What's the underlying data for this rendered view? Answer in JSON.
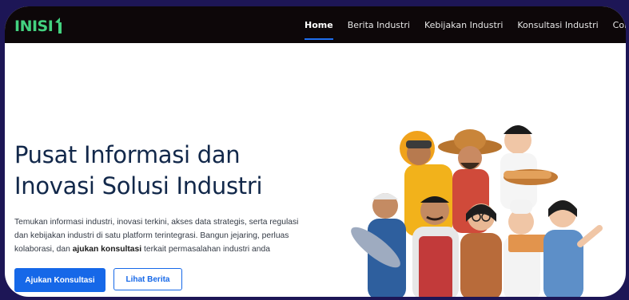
{
  "nav": {
    "logo_text": "INISI",
    "items": [
      {
        "label": "Home",
        "active": true
      },
      {
        "label": "Berita Industri",
        "active": false
      },
      {
        "label": "Kebijakan Industri",
        "active": false
      },
      {
        "label": "Konsultasi Industri",
        "active": false
      },
      {
        "label": "Conta",
        "active": false
      }
    ]
  },
  "hero": {
    "title_line1": "Pusat Informasi dan",
    "title_line2": "Inovasi Solusi Industri",
    "desc_part1": "Temukan informasi industri, inovasi terkini, akses data strategis, serta regulasi dan kebijakan industri di satu platform terintegrasi. Bangun jejaring, perluas kolaborasi, dan ",
    "desc_bold": "ajukan konsultasi",
    "desc_part2": " terkait permasalahan industri anda",
    "primary_button": "Ajukan Konsultasi",
    "secondary_button": "Lihat Berita"
  },
  "colors": {
    "navbar_bg": "#0d0709",
    "accent": "#1668e8",
    "title": "#12284a",
    "logo": "#43d17f",
    "outer_border": "#1d1656"
  },
  "icons": [
    "logo-mark-icon",
    "workers-illustration"
  ]
}
